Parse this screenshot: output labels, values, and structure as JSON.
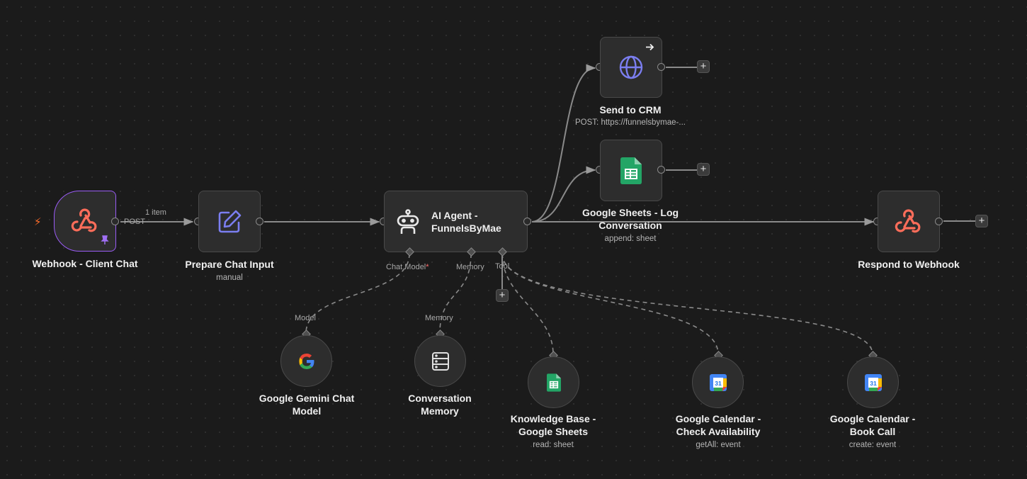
{
  "colors": {
    "accent": "#ff6d5a",
    "trigger_border": "#9a5cf5",
    "agent_icon": "#e8e8e8",
    "globe": "#7b7ef0",
    "sheets": "#23a566",
    "edit_icon": "#7b7ef0"
  },
  "edge_labels": {
    "items": "1 item",
    "post": "POST"
  },
  "nodes": {
    "webhook": {
      "title": "Webhook - Client Chat",
      "icon": "webhook-icon"
    },
    "prepare": {
      "title": "Prepare Chat Input",
      "subtitle": "manual",
      "icon": "edit-icon"
    },
    "agent": {
      "title_line1": "AI Agent -",
      "title_line2": "FunnelsByMae",
      "icon": "robot-icon"
    },
    "crm": {
      "title": "Send to CRM",
      "subtitle": "POST: https://funnelsbymae-...",
      "icon": "globe-icon"
    },
    "sheets_log": {
      "title_line1": "Google Sheets - Log",
      "title_line2": "Conversation",
      "subtitle": "append: sheet",
      "icon": "sheets-icon"
    },
    "respond": {
      "title": "Respond to Webhook",
      "icon": "webhook-icon"
    },
    "gemini": {
      "title_line1": "Google Gemini Chat",
      "title_line2": "Model",
      "icon": "google-icon"
    },
    "memory": {
      "title_line1": "Conversation",
      "title_line2": "Memory",
      "icon": "database-icon"
    },
    "kb": {
      "title_line1": "Knowledge Base -",
      "title_line2": "Google Sheets",
      "subtitle": "read: sheet",
      "icon": "sheets-icon"
    },
    "cal_check": {
      "title_line1": "Google Calendar -",
      "title_line2": "Check Availability",
      "subtitle": "getAll: event",
      "icon": "calendar-icon",
      "day": "31"
    },
    "cal_book": {
      "title_line1": "Google Calendar -",
      "title_line2": "Book Call",
      "subtitle": "create: event",
      "icon": "calendar-icon",
      "day": "31"
    }
  },
  "agent_ports": {
    "chat_model": "Chat Model",
    "required_mark": "*",
    "memory": "Memory",
    "tool": "Tool"
  },
  "sub_ports": {
    "model": "Model",
    "memory": "Memory"
  }
}
